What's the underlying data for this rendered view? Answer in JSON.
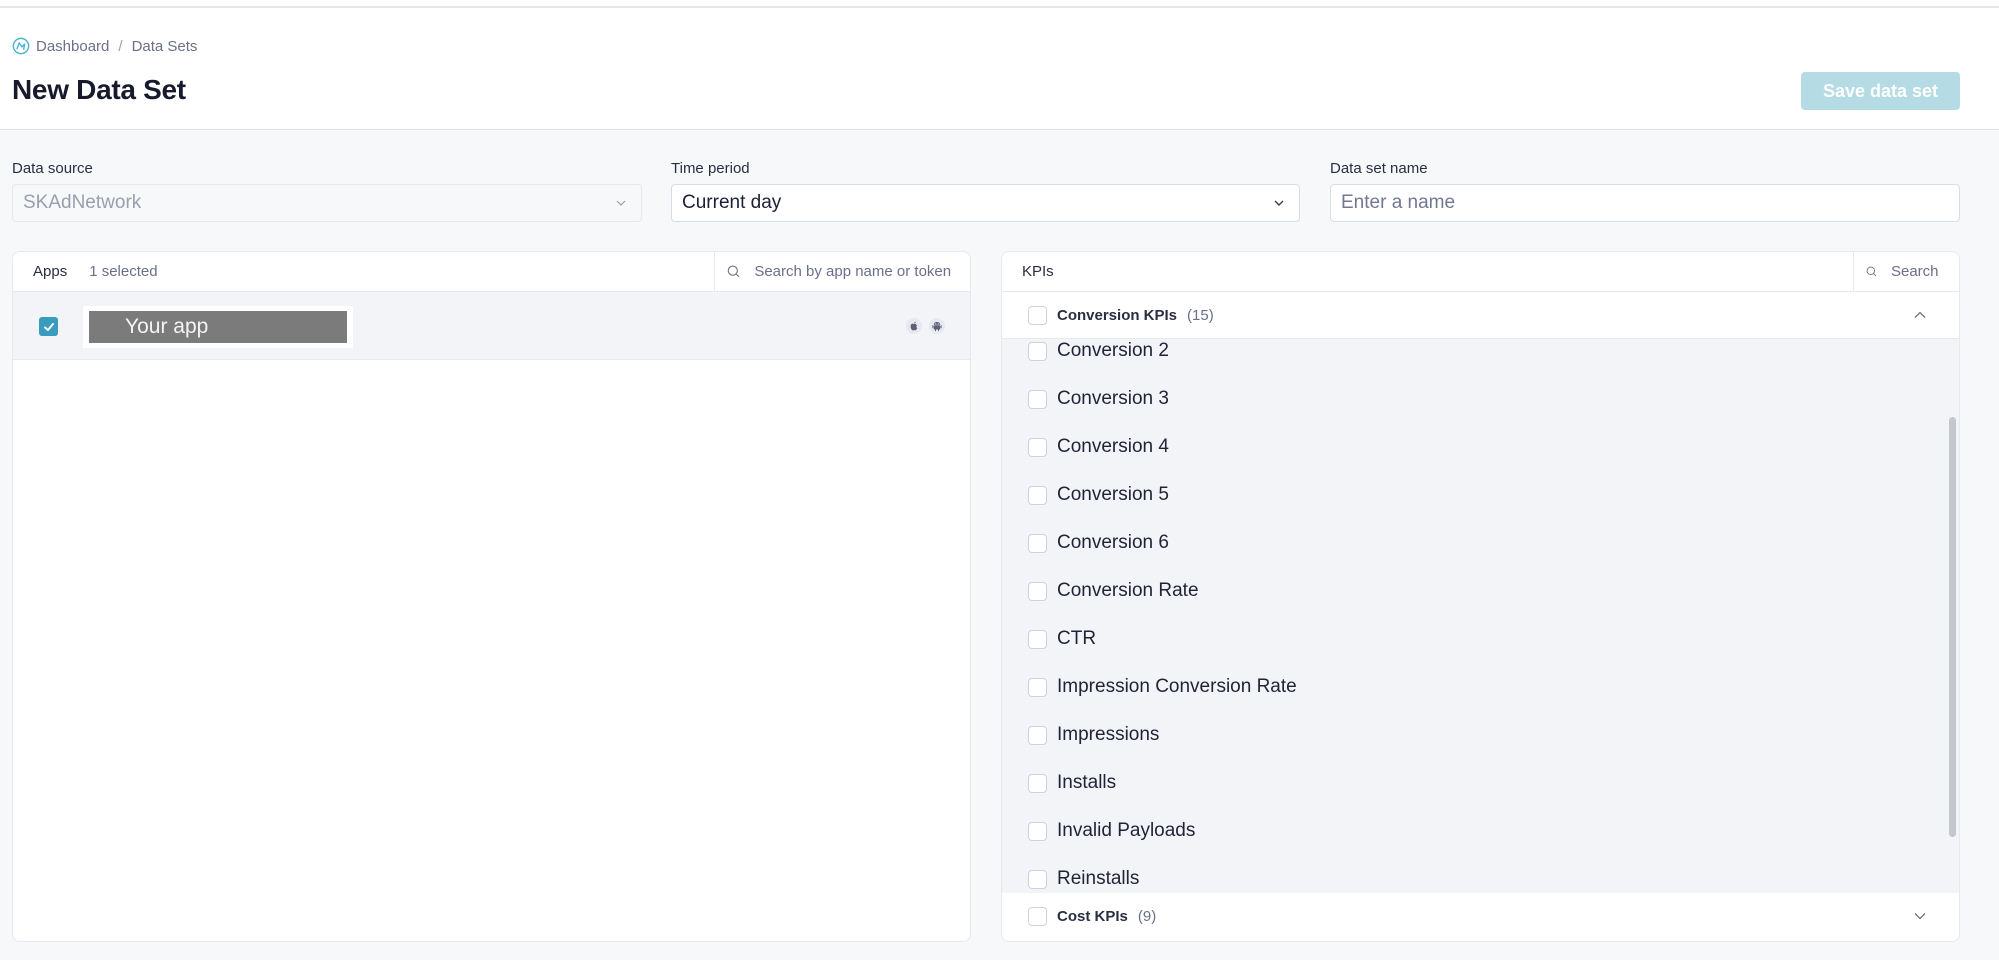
{
  "breadcrumb": {
    "items": [
      "Dashboard",
      "Data Sets"
    ],
    "separator": "/"
  },
  "header": {
    "title": "New Data Set",
    "save_label": "Save data set"
  },
  "form": {
    "data_source": {
      "label": "Data source",
      "value": "SKAdNetwork",
      "disabled": true
    },
    "time_period": {
      "label": "Time period",
      "value": "Current day"
    },
    "data_set_name": {
      "label": "Data set name",
      "value": "",
      "placeholder": "Enter a name"
    }
  },
  "apps_panel": {
    "title": "Apps",
    "selected_count": "1 selected",
    "search_placeholder": "Search by app name or token",
    "apps": [
      {
        "name": "Your app",
        "checked": true,
        "platforms": [
          "apple-icon",
          "android-icon"
        ]
      }
    ]
  },
  "kpis_panel": {
    "title": "KPIs",
    "search_placeholder": "Search",
    "groups": [
      {
        "name": "Conversion KPIs",
        "count": "(15)",
        "expanded": true,
        "items": [
          "Conversion 2",
          "Conversion 3",
          "Conversion 4",
          "Conversion 5",
          "Conversion 6",
          "Conversion Rate",
          "CTR",
          "Impression Conversion Rate",
          "Impressions",
          "Installs",
          "Invalid Payloads",
          "Reinstalls"
        ]
      },
      {
        "name": "Cost KPIs",
        "count": "(9)",
        "expanded": false
      }
    ]
  },
  "colors": {
    "accent": "#3a9cbc",
    "save_button_disabled": "#b5dbe4",
    "logo": "#4bb6cf"
  }
}
